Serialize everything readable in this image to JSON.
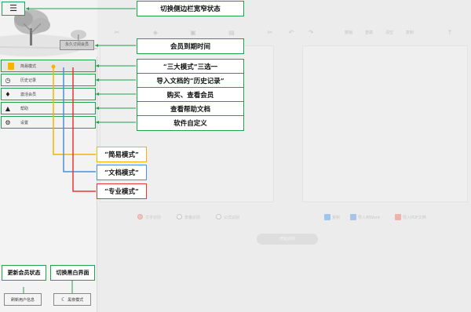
{
  "toolbar": {
    "items": [
      "undo-icon",
      "redo-icon"
    ],
    "labels": [
      "撤销",
      "重做",
      "清空",
      "复制"
    ]
  },
  "options": {
    "radios": [
      "文字识别",
      "表格识别",
      "公式识别"
    ],
    "checks": [
      "复制",
      "导入到Word",
      "导入PDF文档"
    ]
  },
  "convert_label": "开始识别",
  "sidebar": {
    "member_button": "永久订阅会员",
    "items": [
      {
        "label": "简易模式",
        "icon": "mode-icon"
      },
      {
        "label": "历史记录",
        "icon": "clock-icon"
      },
      {
        "label": "激活会员",
        "icon": "diamond-icon"
      },
      {
        "label": "帮助",
        "icon": "warning-icon"
      },
      {
        "label": "设置",
        "icon": "gear-icon"
      }
    ],
    "refresh_button": "刷新用户信息",
    "night_button": "黑夜模式"
  },
  "annotations": {
    "menu": "切换侧边栏宽窄状态",
    "member": "会员到期时间",
    "mode": "“三大模式”三选一",
    "history": "导入文档的“历史记录”",
    "activate": "购买、查看会员",
    "help": "查看帮助文档",
    "settings": "软件自定义",
    "simple": "“简易模式”",
    "doc": "“文档模式”",
    "pro": "“专业模式”",
    "refresh": "更新会员状态",
    "night": "切换黑白界面"
  },
  "colors": {
    "accent": "#21a04e",
    "simple": "#f5b400",
    "doc": "#4a90d9",
    "pro": "#e53935"
  }
}
